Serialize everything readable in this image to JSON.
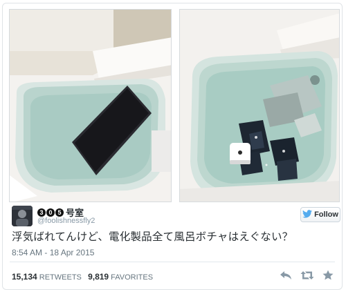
{
  "tweet": {
    "author_name_circled": [
      "3",
      "0",
      "5"
    ],
    "author_name_suffix": "号室",
    "handle": "@foolishnessfly2",
    "follow_label": "Follow",
    "text": "浮気ばれてんけど、電化製品全て風呂ボチャはえぐない？",
    "timestamp": "8:54 AM - 18 Apr 2015",
    "retweets_count": "15,134",
    "retweets_label": "RETWEETS",
    "favorites_count": "9,819",
    "favorites_label": "FAVORITES"
  },
  "icons": {
    "follow": "twitter-bird-icon",
    "reply": "reply-icon",
    "retweet": "retweet-icon",
    "favorite": "star-icon"
  },
  "colors": {
    "text": "#292f33",
    "muted": "#66757f",
    "twitter_blue": "#55acee",
    "icon_gray": "#8899a6"
  }
}
